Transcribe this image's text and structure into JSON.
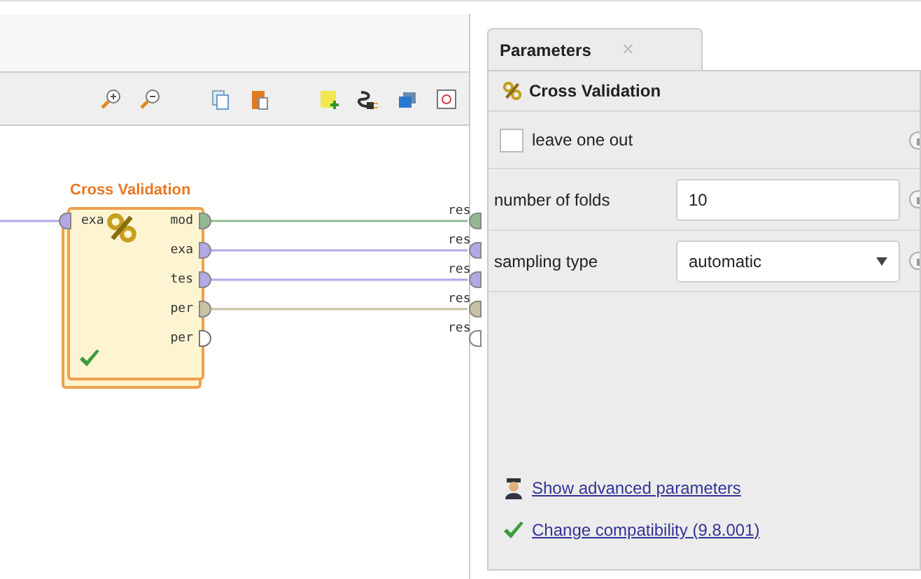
{
  "operator": {
    "title": "Cross Validation",
    "valid": true,
    "inputs": [
      {
        "label": "exa",
        "color": "#b4a8e6"
      }
    ],
    "outputs": [
      {
        "label": "mod",
        "color": "#93b993",
        "connected": true
      },
      {
        "label": "exa",
        "color": "#b4a8e6",
        "connected": true
      },
      {
        "label": "tes",
        "color": "#b4a8e6",
        "connected": true
      },
      {
        "label": "per",
        "color": "#c9c3a3",
        "connected": true
      },
      {
        "label": "per",
        "color": "#ffffff",
        "connected": false
      }
    ]
  },
  "sinks": [
    {
      "label": "res"
    },
    {
      "label": "res"
    },
    {
      "label": "res"
    },
    {
      "label": "res"
    },
    {
      "label": "res"
    }
  ],
  "panel": {
    "tab": {
      "label": "Parameters",
      "close": "×"
    },
    "operator_name": "Cross Validation",
    "parameters": [
      {
        "kind": "checkbox",
        "label": "leave one out",
        "checked": false
      },
      {
        "kind": "text",
        "label": "number of folds",
        "value": "10"
      },
      {
        "kind": "select",
        "label": "sampling type",
        "value": "automatic"
      }
    ],
    "links": [
      {
        "kind": "advanced",
        "label": "Show advanced parameters"
      },
      {
        "kind": "compat",
        "label": "Change compatibility (9.8.001)"
      }
    ]
  }
}
